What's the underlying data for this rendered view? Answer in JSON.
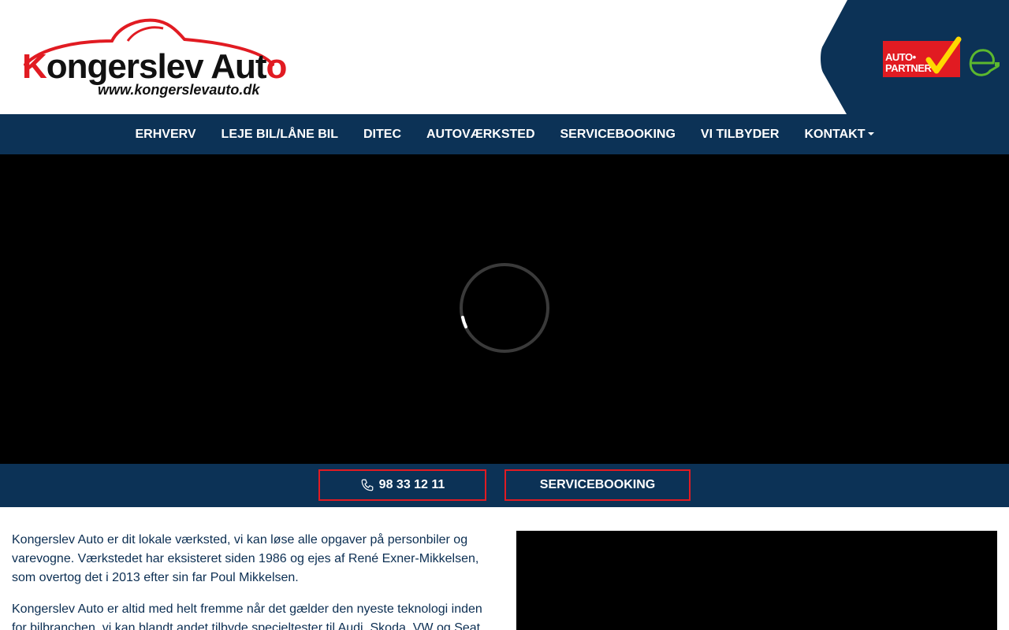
{
  "brand": {
    "name_part1": "K",
    "name_part2": "ongerslev Aut",
    "name_part3": "o",
    "url": "www.kongerslevauto.dk",
    "colors": {
      "primary_navy": "#0c3256",
      "accent_red": "#e11b22",
      "e_green": "#5cb82e"
    }
  },
  "partners": {
    "autopartner_line1": "AUTO•",
    "autopartner_line2": "PARTNER",
    "e_icon": "e-plug-icon"
  },
  "nav": {
    "items": [
      {
        "label": "ERHVERV"
      },
      {
        "label": "LEJE BIL/LÅNE BIL"
      },
      {
        "label": "DITEC"
      },
      {
        "label": "AUTOVÆRKSTED"
      },
      {
        "label": "SERVICEBOOKING"
      },
      {
        "label": "VI TILBYDER"
      },
      {
        "label": "KONTAKT"
      }
    ]
  },
  "hero": {
    "state": "loading",
    "icon": "loading-spinner-icon"
  },
  "cta": {
    "phone_label": "98 33 12 11",
    "phone_icon": "phone-icon",
    "booking_label": "SERVICEBOOKING"
  },
  "content": {
    "paragraph1": "Kongerslev Auto er dit lokale værksted, vi kan løse alle opgaver på personbiler og varevogne. Værkstedet har eksisteret siden 1986 og ejes af René Exner-Mikkelsen, som overtog det i 2013 efter sin far Poul Mikkelsen.",
    "paragraph2": "Kongerslev Auto er altid med helt fremme når det gælder den nyeste teknologi inden for bilbranchen, vi kan blandt andet tilbyde specieltester til Audi, Skoda, VW og Seat."
  }
}
